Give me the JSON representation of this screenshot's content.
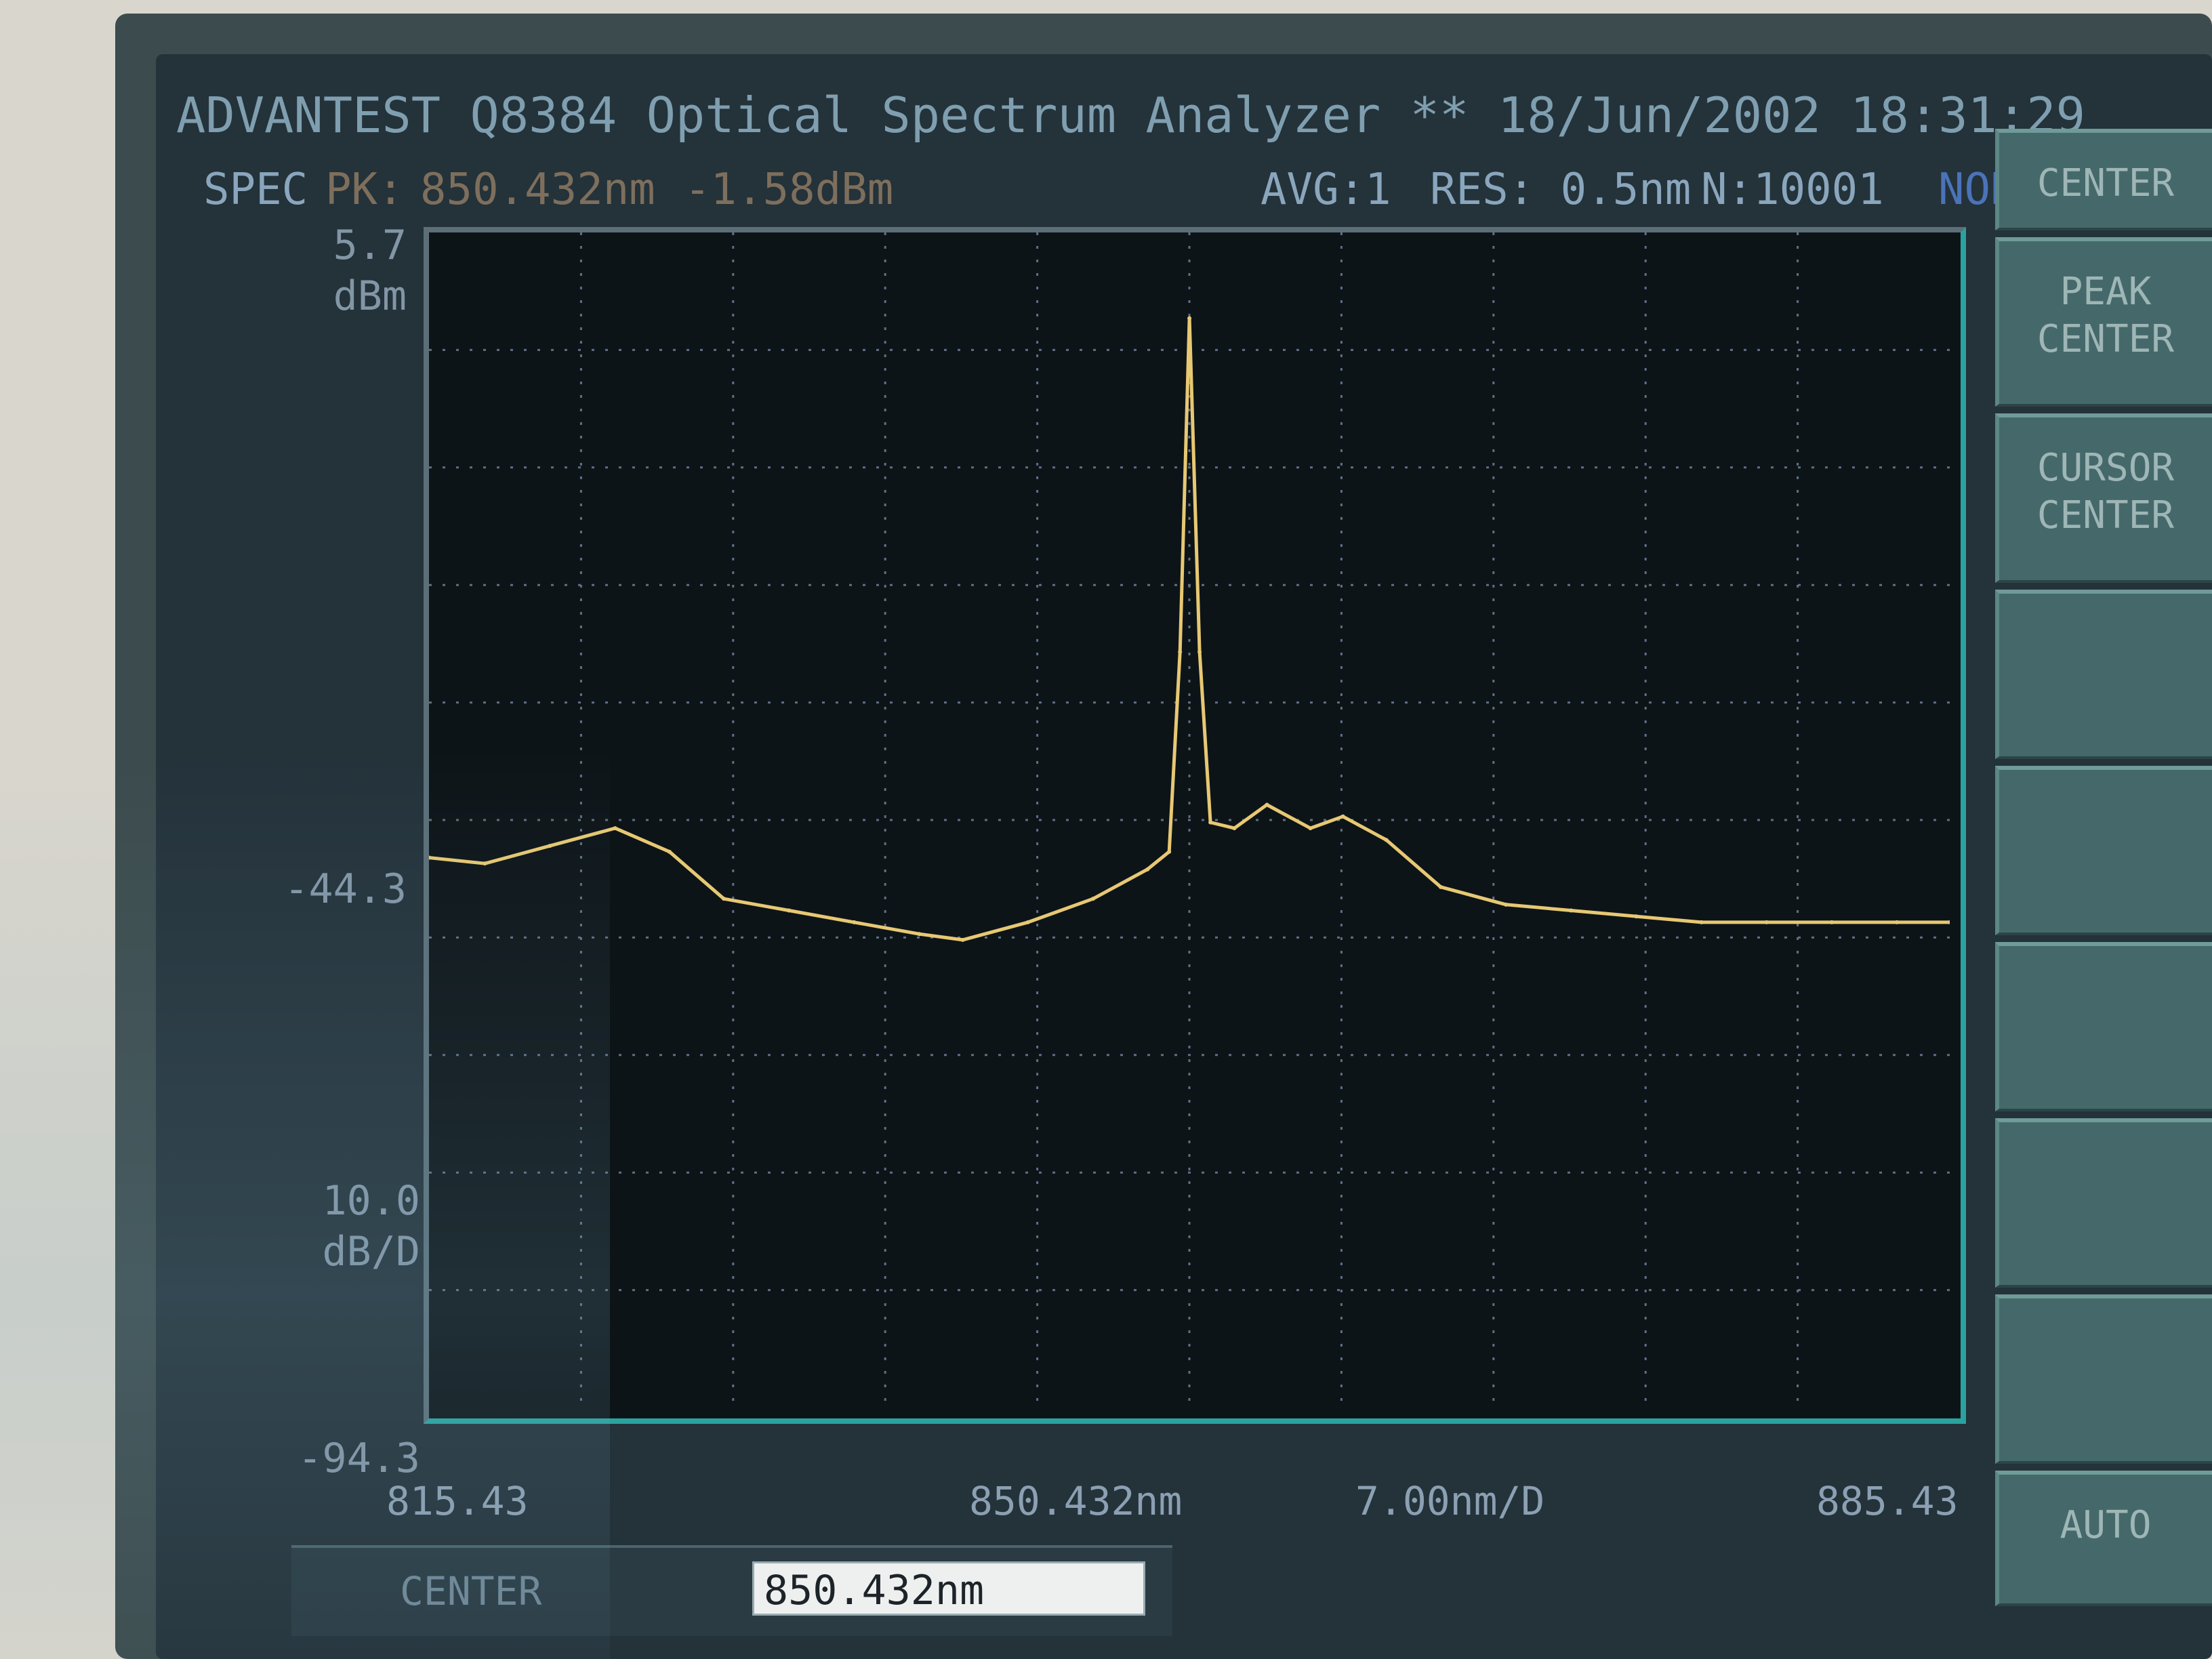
{
  "header": {
    "title": "ADVANTEST Q8384 Optical Spectrum Analyzer **",
    "timestamp": "18/Jun/2002 18:31:29"
  },
  "status": {
    "mode": "SPEC",
    "marker_label": "PK:",
    "marker_wavelength": "850.432nm",
    "marker_level": "-1.58dBm",
    "avg": "AVG:1",
    "res": "RES: 0.5nm",
    "points": "N:10001",
    "sweep_mode": "NORMAL"
  },
  "y_axis": {
    "ref_level": "5.7",
    "ref_unit": "dBm",
    "mid_level": "-44.3",
    "scale": "10.0",
    "scale_unit": "dB/D",
    "bottom_level": "-94.3"
  },
  "x_axis": {
    "start": "815.43",
    "center": "850.432nm",
    "span_per_div": "7.00nm/D",
    "stop": "885.43"
  },
  "input": {
    "label": "CENTER",
    "value": "850.432nm"
  },
  "softkeys": [
    {
      "label": "CENTER"
    },
    {
      "label": "PEAK\nCENTER"
    },
    {
      "label": "CURSOR\nCENTER"
    },
    {
      "label": ""
    },
    {
      "label": ""
    },
    {
      "label": ""
    },
    {
      "label": ""
    },
    {
      "label": ""
    },
    {
      "label": "AUTO"
    }
  ],
  "chart_data": {
    "type": "line",
    "x_unit": "nm",
    "y_unit": "dBm",
    "xlim": [
      815.43,
      885.43
    ],
    "ylim": [
      -94.3,
      5.7
    ],
    "grid": true,
    "trace_color": "#e7c873",
    "x": [
      815.43,
      818.0,
      821.0,
      824.0,
      826.5,
      829.0,
      832.0,
      835.0,
      838.0,
      840.0,
      843.0,
      846.0,
      848.5,
      849.5,
      850.0,
      850.432,
      850.9,
      851.4,
      852.5,
      854.0,
      856.0,
      857.5,
      859.5,
      862.0,
      865.0,
      868.0,
      871.0,
      874.0,
      877.0,
      880.0,
      883.0,
      885.43
    ],
    "y": [
      -47.5,
      -48.0,
      -46.5,
      -45.0,
      -47.0,
      -51.0,
      -52.0,
      -53.0,
      -54.0,
      -54.5,
      -53.0,
      -51.0,
      -48.5,
      -47.0,
      -30.0,
      -1.6,
      -30.0,
      -44.5,
      -45.0,
      -43.0,
      -45.0,
      -44.0,
      -46.0,
      -50.0,
      -51.5,
      -52.0,
      -52.5,
      -53.0,
      -53.0,
      -53.0,
      -53.0,
      -53.0
    ]
  },
  "colors": {
    "trace": "#e7c873",
    "grid": "#5f6f86",
    "plot_border": "#2aa3a0",
    "softkey": "#45696a"
  }
}
